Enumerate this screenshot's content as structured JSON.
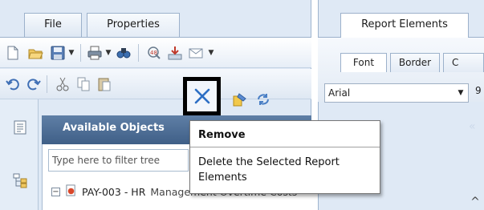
{
  "left_tabs": [
    {
      "label": "File",
      "active": true
    },
    {
      "label": "Properties",
      "active": false
    }
  ],
  "right_tabs": [
    {
      "label": "Report Elements",
      "active": true
    }
  ],
  "right_subtabs": [
    {
      "label": "Font",
      "active": true
    },
    {
      "label": "Border",
      "active": false
    },
    {
      "label": "C",
      "active": false
    }
  ],
  "font_select": {
    "value": "Arial",
    "size_partial": "9"
  },
  "toolbar1_icons": [
    "new-document-icon",
    "open-folder-icon",
    "save-icon",
    "print-icon",
    "find-icon",
    "refresh-data-icon",
    "export-icon",
    "email-icon"
  ],
  "toolbar2_icons": [
    "undo-icon",
    "redo-icon",
    "cut-icon",
    "copy-icon",
    "paste-icon",
    "remove-icon",
    "format-painter-icon",
    "purge-icon"
  ],
  "available_objects": {
    "title": "Available Objects",
    "filter_placeholder": "Type here to filter tree",
    "tree_root": "PAY-003 - HR",
    "tree_root_trailing": "Management Overtime Costs",
    "collapse_glyph": "«"
  },
  "tooltip": {
    "title": "Remove",
    "description": "Delete the Selected Report Elements"
  },
  "colors": {
    "panel_header": "#4a6a93",
    "pane_background": "#dfe9f5",
    "highlight_border": "#000000"
  }
}
